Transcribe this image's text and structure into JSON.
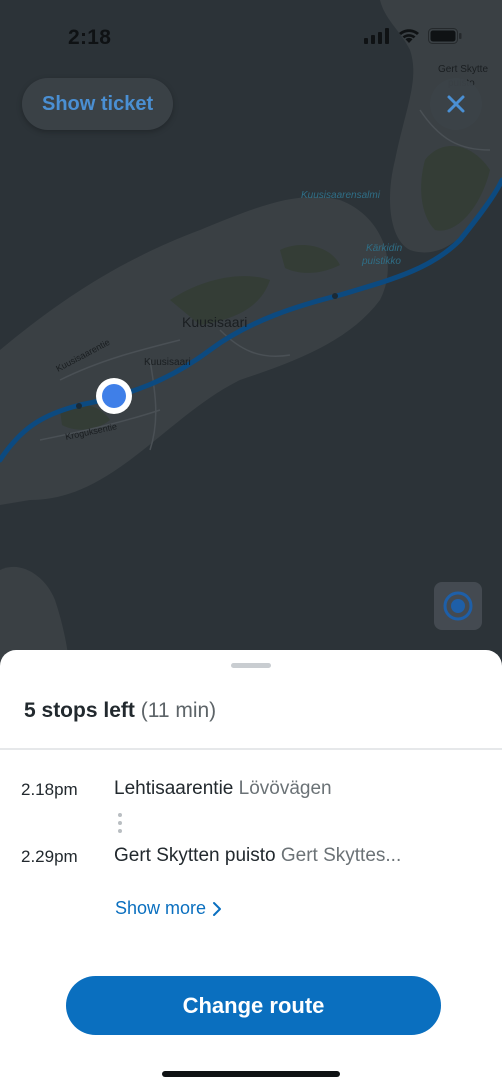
{
  "status_bar": {
    "time": "2:18"
  },
  "map": {
    "labels": {
      "kuusisaari": "Kuusisaari",
      "kuusisaarensalmi": "Kuusisaarensalmi",
      "karkidin_puistikko_1": "Kärkidin",
      "karkidin_puistikko_2": "puistikko",
      "kuusisaarentie": "Kuusisaarentie",
      "kuusisaari_small": "Kuusisaari",
      "kroguksentie": "Kroguksentie",
      "gert_skytten": "Gert Skytte",
      "puisto": "puisto"
    }
  },
  "buttons": {
    "show_ticket": "Show ticket",
    "change_route": "Change route",
    "show_more": "Show more"
  },
  "summary": {
    "stops_left": "5 stops left",
    "duration": "(11 min)"
  },
  "stops": [
    {
      "time": "2.18pm",
      "name": "Lehtisaarentie",
      "alt_name": "Lövövägen"
    },
    {
      "time": "2.29pm",
      "name": "Gert Skytten puisto",
      "alt_name": "Gert Skyttes..."
    }
  ],
  "icons": {
    "close": "close-icon",
    "locate": "locate-icon",
    "signal": "signal-icon",
    "wifi": "wifi-icon",
    "battery": "battery-icon",
    "chevron": "chevron-right-icon"
  },
  "colors": {
    "accent": "#0a6fbf",
    "route": "#0c4a80",
    "position": "#3f7fe8"
  }
}
